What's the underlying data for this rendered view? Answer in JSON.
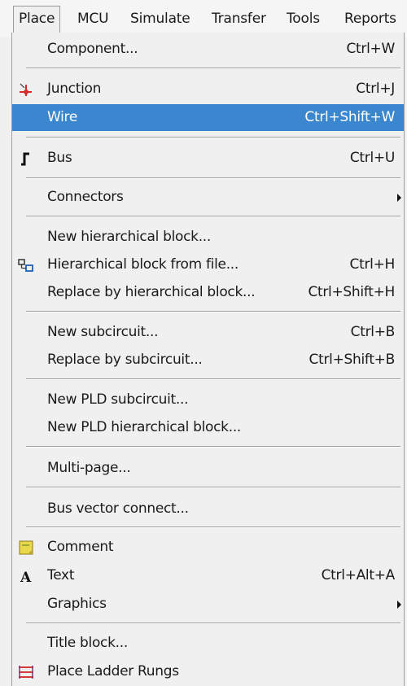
{
  "menubar": {
    "items": [
      {
        "label": "Place"
      },
      {
        "label": "MCU"
      },
      {
        "label": "Simulate"
      },
      {
        "label": "Transfer"
      },
      {
        "label": "Tools"
      },
      {
        "label": "Reports"
      }
    ]
  },
  "menu": {
    "items": [
      {
        "label": "Component...",
        "shortcut": "Ctrl+W"
      },
      {
        "label": "Junction",
        "shortcut": "Ctrl+J",
        "icon": "junction-icon"
      },
      {
        "label": "Wire",
        "shortcut": "Ctrl+Shift+W",
        "highlighted": true
      },
      {
        "label": "Bus",
        "shortcut": "Ctrl+U",
        "icon": "bus-icon"
      },
      {
        "label": "Connectors",
        "submenu": true
      },
      {
        "label": "New hierarchical block..."
      },
      {
        "label": "Hierarchical block from file...",
        "shortcut": "Ctrl+H",
        "icon": "hierarchical-block-icon"
      },
      {
        "label": "Replace by hierarchical block...",
        "shortcut": "Ctrl+Shift+H"
      },
      {
        "label": "New subcircuit...",
        "shortcut": "Ctrl+B"
      },
      {
        "label": "Replace by subcircuit...",
        "shortcut": "Ctrl+Shift+B"
      },
      {
        "label": "New PLD subcircuit..."
      },
      {
        "label": "New PLD hierarchical block..."
      },
      {
        "label": "Multi-page..."
      },
      {
        "label": "Bus vector connect..."
      },
      {
        "label": "Comment",
        "icon": "comment-icon"
      },
      {
        "label": "Text",
        "shortcut": "Ctrl+Alt+A",
        "icon": "text-icon"
      },
      {
        "label": "Graphics",
        "submenu": true
      },
      {
        "label": "Title block..."
      },
      {
        "label": "Place Ladder Rungs",
        "icon": "ladder-rungs-icon"
      }
    ]
  },
  "colors": {
    "highlight": "#3a86cf",
    "background": "#f0f0f0",
    "junction_icon": "#d62b2b",
    "comment_icon": "#e8d84a",
    "ladder_icon": "#d63a3a"
  }
}
